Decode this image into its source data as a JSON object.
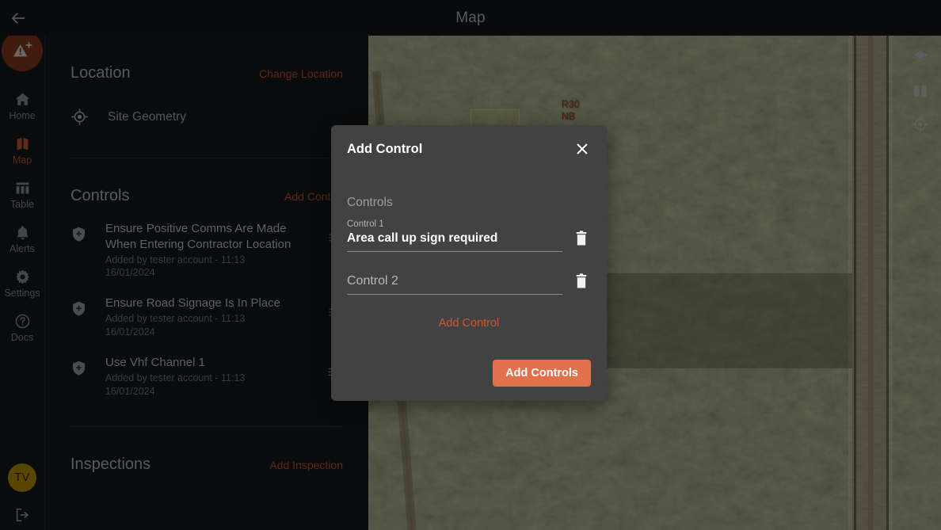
{
  "topbar": {
    "back_icon": "arrow-left-icon",
    "title": "Map"
  },
  "rail": {
    "alert_button": {
      "icon": "add-alert-icon",
      "label": ""
    },
    "items": [
      {
        "icon": "home-icon",
        "label": "Home",
        "active": false
      },
      {
        "icon": "map-icon",
        "label": "Map",
        "active": true
      },
      {
        "icon": "table-icon",
        "label": "Table",
        "active": false
      },
      {
        "icon": "bell-icon",
        "label": "Alerts",
        "active": false
      },
      {
        "icon": "gear-icon",
        "label": "Settings",
        "active": false
      },
      {
        "icon": "question-icon",
        "label": "Docs",
        "active": false
      }
    ],
    "user_initials": "TV",
    "logout_icon": "logout-icon"
  },
  "panel": {
    "location": {
      "title": "Location",
      "action": "Change Location",
      "row_icon": "crosshair-icon",
      "row_label": "Site Geometry"
    },
    "controls": {
      "title": "Controls",
      "action": "Add Control",
      "items": [
        {
          "icon": "shield-check-icon",
          "name": "Ensure Positive Comms Are Made When Entering Contractor Location",
          "meta": "Added by tester account - 11:13 16/01/2024",
          "trailing_icon": "drag-handle-icon"
        },
        {
          "icon": "shield-check-icon",
          "name": "Ensure Road Signage Is In Place",
          "meta": "Added by tester account - 11:13 16/01/2024",
          "trailing_icon": "drag-handle-icon"
        },
        {
          "icon": "shield-check-icon",
          "name": "Use Vhf Channel 1",
          "meta": "Added by tester account - 11:13 16/01/2024",
          "trailing_icon": "edit-list-icon"
        }
      ]
    },
    "inspections": {
      "title": "Inspections",
      "action": "Add Inspection"
    }
  },
  "map": {
    "label": "R30\nNB",
    "tools": [
      {
        "icon": "layers-icon"
      },
      {
        "icon": "map-folded-icon"
      },
      {
        "icon": "locate-icon"
      }
    ]
  },
  "modal": {
    "title": "Add Control",
    "close_icon": "close-icon",
    "section_label": "Controls",
    "fields": [
      {
        "float_label": "Control 1",
        "value": "Area call up sign required",
        "placeholder": "Control 1",
        "delete_icon": "trash-icon"
      },
      {
        "float_label": "",
        "value": "",
        "placeholder": "Control 2",
        "delete_icon": "trash-icon"
      }
    ],
    "add_link": "Add Control",
    "submit_label": "Add Controls"
  },
  "colors": {
    "accent": "#c2552b",
    "accent_button": "#e1714a",
    "modal_bg": "#424242",
    "panel_bg": "#14171d",
    "polygon": "#ddd445",
    "map_label": "#c0392b",
    "avatar_bg": "#b99508",
    "alert_bg": "#8b3a20"
  }
}
